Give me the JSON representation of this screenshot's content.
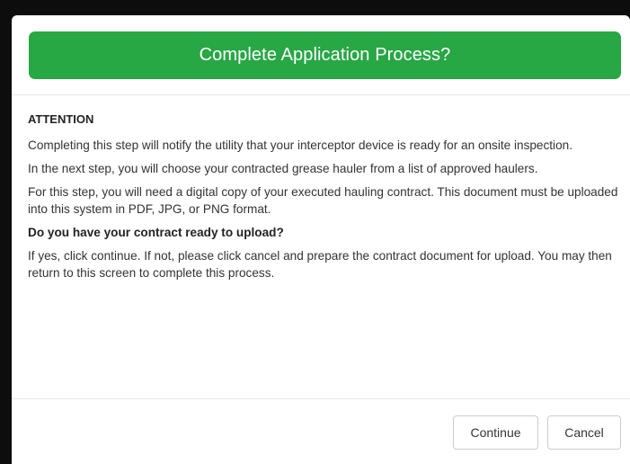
{
  "dialog": {
    "title": "Complete Application Process?",
    "title_color": "#28a745"
  },
  "body": {
    "attention": "ATTENTION",
    "paragraphs": [
      "Completing this step will notify the utility that your interceptor device is ready for an onsite inspection.",
      "In the next step, you will choose your contracted grease hauler from a list of approved haulers.",
      "For this step, you will need a digital copy of your executed hauling contract. This document must be uploaded into this system in PDF, JPG, or PNG format."
    ],
    "question": "Do you have your contract ready to upload?",
    "instruction": "If yes, click continue. If not, please click cancel and prepare the contract document for upload. You may then return to this screen to complete this process."
  },
  "footer": {
    "continue_label": "Continue",
    "cancel_label": "Cancel"
  }
}
